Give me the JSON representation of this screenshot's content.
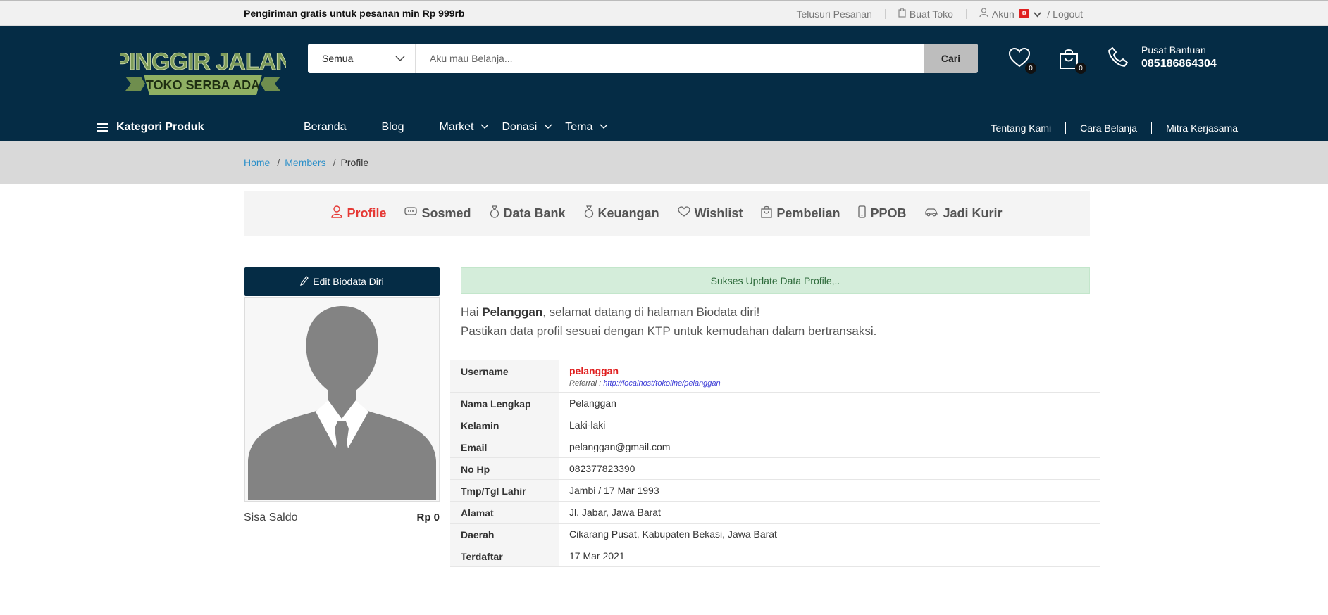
{
  "topbar": {
    "promo": "Pengiriman gratis untuk pesanan min Rp 999rb",
    "track_order": "Telusuri Pesanan",
    "create_shop": "Buat Toko",
    "account": "Akun",
    "account_badge": "0",
    "logout": "/ Logout"
  },
  "header": {
    "logo_line1": "PINGGIR JALAN",
    "logo_line2": "TOKO SERBA ADA",
    "search_category": "Semua",
    "search_placeholder": "Aku mau Belanja...",
    "search_button": "Cari",
    "wishlist_count": "0",
    "cart_count": "0",
    "help_label": "Pusat Bantuan",
    "help_phone": "085186864304"
  },
  "nav": {
    "categories": "Kategori Produk",
    "menu": [
      "Beranda",
      "Blog",
      "Market",
      "Donasi",
      "Tema"
    ],
    "right": [
      "Tentang Kami",
      "Cara Belanja",
      "Mitra Kerjasama"
    ]
  },
  "breadcrumb": [
    "Home",
    "Members",
    "Profile"
  ],
  "tabs": [
    "Profile",
    "Sosmed",
    "Data Bank",
    "Keuangan",
    "Wishlist",
    "Pembelian",
    "PPOB",
    "Jadi Kurir"
  ],
  "left": {
    "edit_button": "Edit Biodata Diri",
    "saldo_label": "Sisa Saldo",
    "saldo_value": "Rp 0"
  },
  "alert": "Sukses Update Data Profile,..",
  "greeting": {
    "hai": "Hai",
    "name": "Pelanggan",
    "line1_rest": ", selamat datang di halaman Biodata diri!",
    "line2": "Pastikan data profil sesuai dengan KTP untuk kemudahan dalam bertransaksi."
  },
  "profile": {
    "username_label": "Username",
    "username": "pelanggan",
    "referral_label": "Referral :",
    "referral_url": "http://localhost/tokoline/pelanggan",
    "rows": [
      {
        "label": "Nama Lengkap",
        "value": "Pelanggan"
      },
      {
        "label": "Kelamin",
        "value": "Laki-laki"
      },
      {
        "label": "Email",
        "value": "pelanggan@gmail.com"
      },
      {
        "label": "No Hp",
        "value": "082377823390"
      },
      {
        "label": "Tmp/Tgl Lahir",
        "value": "Jambi / 17 Mar 1993"
      },
      {
        "label": "Alamat",
        "value": "Jl. Jabar, Jawa Barat"
      },
      {
        "label": "Daerah",
        "value": "Cikarang Pusat, Kabupaten Bekasi, Jawa Barat"
      },
      {
        "label": "Terdaftar",
        "value": "17 Mar 2021"
      }
    ]
  },
  "colors": {
    "header_bg": "#052c45",
    "accent_red": "#e53935",
    "link_blue": "#2a8fc9"
  }
}
